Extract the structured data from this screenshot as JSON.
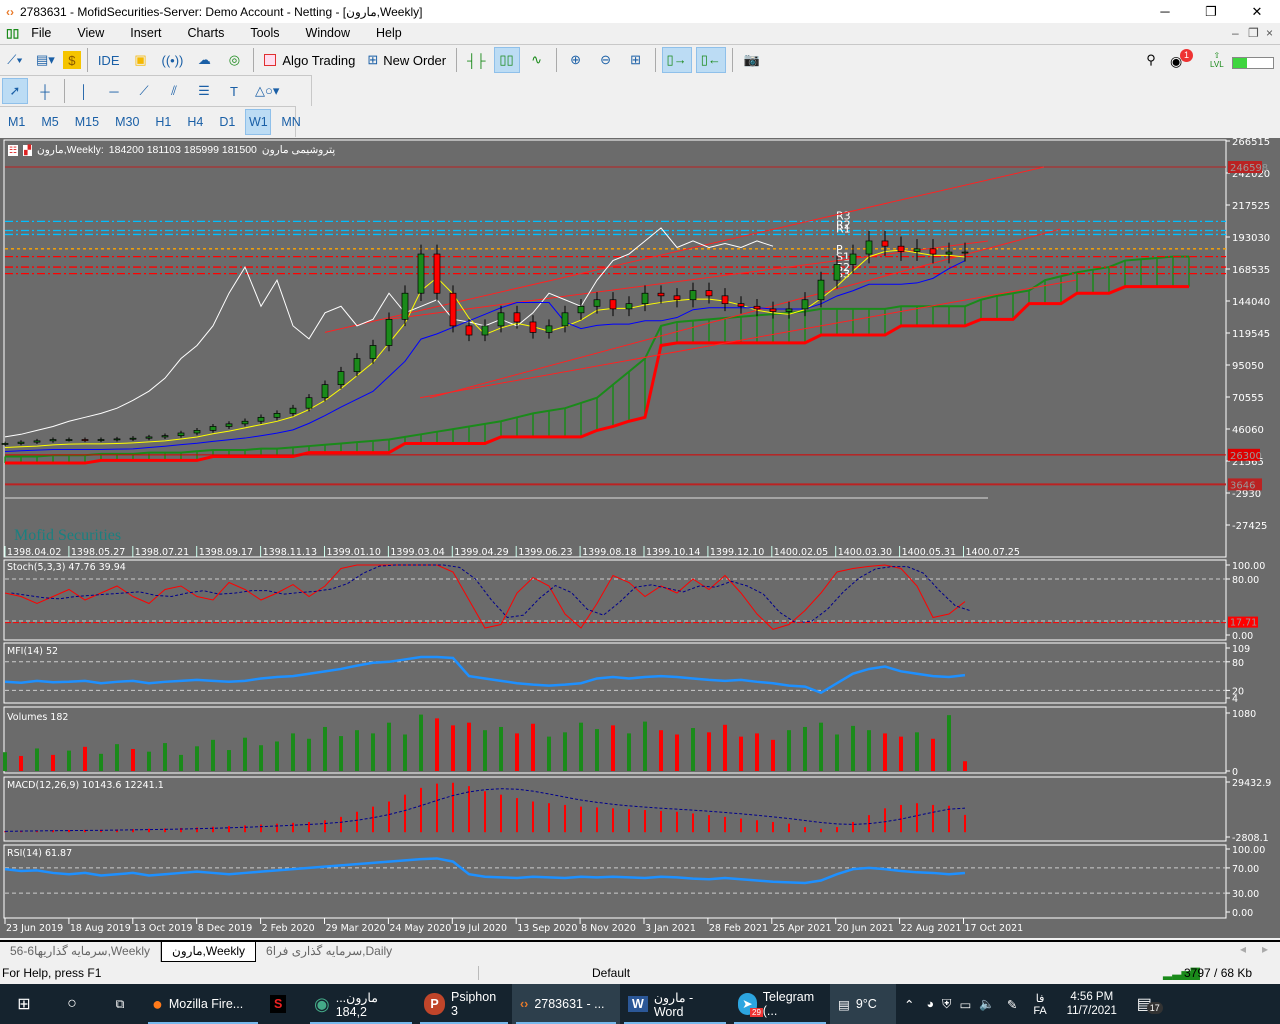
{
  "window": {
    "title": "2783631 - MofidSecurities-Server: Demo Account - Netting - [مارون,Weekly]",
    "minimize": "─",
    "maximize": "❐",
    "close": "✕"
  },
  "menu": [
    "File",
    "View",
    "Insert",
    "Charts",
    "Tools",
    "Window",
    "Help"
  ],
  "toolbar": {
    "ide": "IDE",
    "algo_trading": "Algo Trading",
    "new_order": "New Order",
    "notification_count": "1",
    "level_label": "LVL",
    "level_fill_pct": 35
  },
  "timeframes": [
    "M1",
    "M5",
    "M15",
    "M30",
    "H1",
    "H4",
    "D1",
    "W1",
    "MN"
  ],
  "active_timeframe": "W1",
  "chart": {
    "symbol_label": "مارون,Weekly:",
    "ohlc": "184200 181103 185999 181500",
    "description": "پتروشیمی مارون",
    "watermark": "Mofid Securities",
    "pivot_labels": [
      "R3",
      "R2",
      "R1",
      "P",
      "S1",
      "S2",
      "S3"
    ],
    "price_ticks": [
      "266515",
      "242020",
      "217525",
      "193030",
      "168535",
      "144040",
      "119545",
      "95050",
      "70555",
      "46060",
      "21565",
      "-2930",
      "-27425"
    ],
    "price_tags": [
      "246598",
      "26300",
      "3646"
    ],
    "persian_dates": [
      "1398.04.02",
      "1398.05.27",
      "1398.07.21",
      "1398.09.17",
      "1398.11.13",
      "1399.01.10",
      "1399.03.04",
      "1399.04.29",
      "1399.06.23",
      "1399.08.18",
      "1399.10.14",
      "1399.12.10",
      "1400.02.05",
      "1400.03.30",
      "1400.05.31",
      "1400.07.25"
    ],
    "dates": [
      "23 Jun 2019",
      "18 Aug 2019",
      "13 Oct 2019",
      "8 Dec 2019",
      "2 Feb 2020",
      "29 Mar 2020",
      "24 May 2020",
      "19 Jul 2020",
      "13 Sep 2020",
      "8 Nov 2020",
      "3 Jan 2021",
      "28 Feb 2021",
      "25 Apr 2021",
      "20 Jun 2021",
      "22 Aug 2021",
      "17 Oct 2021"
    ],
    "colors": {
      "bg": "#6b6b6b",
      "bull": "#1a8a1a",
      "bear": "#ff0000",
      "overlay": "#ffffff",
      "tenkan": "#ffff00",
      "kijun": "#0000ff",
      "pivot_r": "#00bfff",
      "pivot_p": "#ffa500",
      "pivot_s": "#ff0000"
    }
  },
  "chart_data": [
    {
      "type": "candlestick",
      "title": "مارون,Weekly",
      "interval": "2 weeks per point",
      "close": [
        35000,
        36000,
        37000,
        38000,
        38000,
        37500,
        38000,
        38500,
        39000,
        40000,
        41000,
        43000,
        45000,
        48000,
        50000,
        52000,
        55000,
        58000,
        62000,
        70000,
        80000,
        90000,
        100000,
        110000,
        130000,
        150000,
        180000,
        150000,
        125000,
        118000,
        125000,
        135000,
        128000,
        120000,
        125000,
        135000,
        140000,
        145000,
        138000,
        142000,
        150000,
        148000,
        145000,
        152000,
        148000,
        142000,
        140000,
        138000,
        136000,
        138000,
        145000,
        160000,
        172000,
        180000,
        190000,
        186000,
        182000,
        184000,
        180000,
        181500,
        181500
      ],
      "overlay_line": [
        40000,
        42000,
        45000,
        48000,
        52000,
        55000,
        58000,
        62000,
        68000,
        75000,
        85000,
        100000,
        110000,
        125000,
        150000,
        170000,
        140000,
        160000,
        125000,
        115000,
        135000,
        140000,
        125000,
        130000,
        150000,
        135000,
        140000,
        145000,
        130000,
        128000,
        125000,
        130000,
        125000,
        135000,
        150000,
        145000,
        140000,
        160000,
        175000,
        180000,
        190000,
        200000,
        185000,
        190000,
        185000,
        188000,
        185000,
        190000,
        186000
      ],
      "cloud_upper": [
        25000,
        25000,
        25000,
        26000,
        26000,
        26000,
        27000,
        27000,
        27000,
        28000,
        28000,
        28000,
        29000,
        30000,
        30000,
        30000,
        31000,
        31000,
        32000,
        33000,
        34000,
        35000,
        36000,
        37000,
        38000,
        40000,
        42000,
        44000,
        46000,
        48000,
        50000,
        52000,
        55000,
        58000,
        60000,
        62000,
        66000,
        70000,
        80000,
        90000,
        100000,
        125000,
        128000,
        129000,
        130000,
        131000,
        132000,
        133000,
        134000,
        135000,
        136000,
        138000,
        138000,
        138000,
        138000,
        138000,
        140000,
        140000,
        140000,
        140000,
        140000,
        145000,
        148000,
        150000,
        152000,
        160000,
        163000,
        166000,
        168000,
        170000,
        175000,
        176000,
        177000,
        178000,
        178000
      ],
      "cloud_lower": [
        20000,
        20000,
        20000,
        20000,
        20000,
        20000,
        22000,
        22000,
        22000,
        22000,
        22000,
        22000,
        22000,
        25000,
        25000,
        25000,
        25000,
        25000,
        25000,
        28000,
        28000,
        28000,
        28000,
        28000,
        28000,
        35000,
        35000,
        35000,
        35000,
        35000,
        35000,
        40000,
        40000,
        40000,
        40000,
        40000,
        40000,
        45000,
        48000,
        52000,
        55000,
        110000,
        112000,
        112000,
        112000,
        112000,
        112000,
        112000,
        112000,
        112000,
        112000,
        118000,
        118000,
        118000,
        118000,
        118000,
        125000,
        125000,
        125000,
        125000,
        125000,
        130000,
        130000,
        130000,
        142000,
        142000,
        142000,
        150000,
        150000,
        150000,
        155000,
        155000,
        155000,
        155000,
        155000
      ],
      "pivots": {
        "R3": 205000,
        "R2": 198000,
        "R1": 195000,
        "P": 184000,
        "S1": 178000,
        "S2": 170000,
        "S3": 165000
      },
      "ylim": [
        -27425,
        266515
      ]
    },
    {
      "type": "line",
      "title": "Stoch(5,3,3) 47.76 39.94",
      "ylim": [
        0,
        100
      ],
      "levels": [
        80,
        20
      ],
      "tag": "17.71",
      "values": [
        60,
        55,
        45,
        55,
        65,
        50,
        60,
        70,
        55,
        45,
        65,
        70,
        55,
        50,
        75,
        65,
        50,
        60,
        72,
        55,
        70,
        95,
        100,
        100,
        100,
        100,
        100,
        100,
        90,
        50,
        10,
        15,
        60,
        82,
        70,
        30,
        10,
        45,
        85,
        75,
        55,
        70,
        60,
        80,
        65,
        85,
        60,
        30,
        8,
        15,
        35,
        60,
        90,
        95,
        98,
        100,
        95,
        70,
        25,
        30,
        47.76
      ]
    },
    {
      "type": "line",
      "title": "MFI(14) 52",
      "ylim": [
        4,
        109
      ],
      "levels": [
        80,
        20
      ],
      "values": [
        38,
        36,
        40,
        37,
        38,
        40,
        35,
        38,
        40,
        35,
        38,
        40,
        42,
        40,
        38,
        40,
        45,
        48,
        50,
        55,
        60,
        65,
        72,
        78,
        80,
        85,
        90,
        90,
        88,
        50,
        45,
        40,
        35,
        32,
        30,
        32,
        35,
        45,
        48,
        45,
        48,
        50,
        48,
        45,
        42,
        40,
        42,
        38,
        35,
        30,
        28,
        15,
        35,
        55,
        65,
        70,
        60,
        55,
        50,
        48,
        52
      ]
    },
    {
      "type": "bar",
      "title": "Volumes 182",
      "ylim": [
        0,
        1080
      ],
      "values": [
        350,
        280,
        420,
        300,
        380,
        450,
        320,
        500,
        410,
        360,
        520,
        300,
        460,
        580,
        390,
        620,
        480,
        550,
        700,
        600,
        820,
        650,
        760,
        700,
        900,
        680,
        1050,
        980,
        850,
        900,
        760,
        820,
        700,
        880,
        640,
        720,
        900,
        780,
        850,
        700,
        920,
        760,
        680,
        800,
        720,
        860,
        640,
        700,
        580,
        760,
        820,
        900,
        680,
        840,
        760,
        700,
        640,
        720,
        600,
        1040,
        182
      ],
      "up": [
        1,
        0,
        1,
        0,
        1,
        0,
        1,
        1,
        0,
        1,
        1,
        1,
        1,
        1,
        1,
        1,
        1,
        1,
        1,
        1,
        1,
        1,
        1,
        1,
        1,
        1,
        1,
        0,
        0,
        0,
        1,
        1,
        0,
        0,
        1,
        1,
        1,
        1,
        0,
        1,
        1,
        0,
        0,
        1,
        0,
        0,
        0,
        0,
        0,
        1,
        1,
        1,
        1,
        1,
        1,
        0,
        0,
        1,
        0,
        1,
        0
      ]
    },
    {
      "type": "bar",
      "title": "MACD(12,26,9) 10143.6 12241.1",
      "ylim": [
        -2808.1,
        29432.9
      ],
      "values": [
        500,
        800,
        1000,
        1200,
        1300,
        1400,
        1500,
        1600,
        1800,
        2000,
        2200,
        2500,
        2800,
        3200,
        3600,
        4000,
        4500,
        5000,
        5500,
        6000,
        7000,
        9000,
        12000,
        15000,
        18000,
        22000,
        26000,
        28500,
        29000,
        27000,
        24000,
        22000,
        20000,
        18000,
        17000,
        16000,
        15000,
        14500,
        14000,
        13500,
        13000,
        12500,
        12000,
        11000,
        10000,
        9000,
        8000,
        7000,
        6000,
        5000,
        3000,
        2000,
        3000,
        6000,
        10000,
        14000,
        16000,
        17000,
        16000,
        15500,
        10143.6
      ]
    },
    {
      "type": "line",
      "title": "RSI(14) 61.87",
      "ylim": [
        0,
        100
      ],
      "levels": [
        70,
        30
      ],
      "values": [
        68,
        65,
        66,
        62,
        60,
        62,
        58,
        60,
        62,
        58,
        60,
        62,
        64,
        62,
        60,
        62,
        64,
        66,
        68,
        70,
        72,
        74,
        76,
        78,
        80,
        82,
        84,
        85,
        80,
        60,
        56,
        55,
        54,
        56,
        55,
        54,
        56,
        55,
        56,
        55,
        54,
        56,
        55,
        53,
        52,
        54,
        52,
        50,
        48,
        47,
        46,
        50,
        60,
        68,
        70,
        68,
        65,
        63,
        62,
        60,
        61.87
      ]
    }
  ],
  "sub_ticks": {
    "stoch": [
      "100.00",
      "80.00",
      "0.00"
    ],
    "mfi": [
      "109",
      "80",
      "20",
      "4"
    ],
    "volume": [
      "1080",
      "0"
    ],
    "macd": [
      "29432.9",
      "-2808.1"
    ],
    "rsi": [
      "100.00",
      "70.00",
      "30.00",
      "0.00"
    ]
  },
  "tabs": [
    "56-6سرمایه گذاریها,Weekly",
    "مارون,Weekly",
    "سرمایه گذاری فرا6,Daily"
  ],
  "status": {
    "help": "For Help, press F1",
    "profile": "Default",
    "traffic": "3797 / 68 Kb"
  },
  "taskbar": {
    "apps": [
      "Mozilla Fire...",
      "...مارون 184,2",
      "Psiphon 3",
      "2783631 - ...",
      "مارون - Word",
      "Telegram (..."
    ],
    "telegram_badge": "29",
    "weather": "9°C",
    "lang_top": "فا",
    "lang": "FA",
    "time": "4:56 PM",
    "date": "11/7/2021",
    "notifications": "17"
  }
}
